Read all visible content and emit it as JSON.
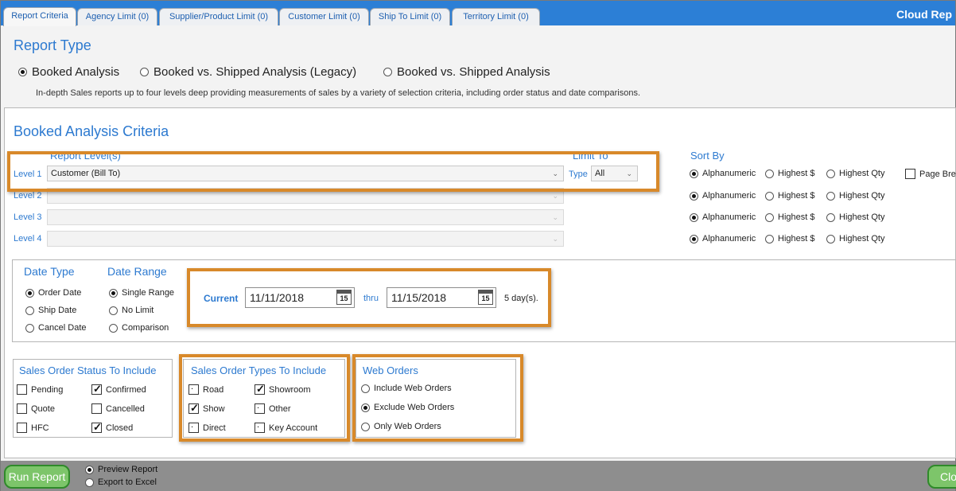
{
  "app": {
    "brand": "Cloud Rep"
  },
  "tabs": [
    {
      "label": "Report Criteria"
    },
    {
      "label": "Agency Limit (0)"
    },
    {
      "label": "Supplier/Product Limit (0)"
    },
    {
      "label": "Customer Limit (0)"
    },
    {
      "label": "Ship To Limit (0)"
    },
    {
      "label": "Territory Limit (0)"
    }
  ],
  "report_type": {
    "title": "Report Type",
    "options": [
      {
        "label": "Booked Analysis",
        "selected": true
      },
      {
        "label": "Booked vs. Shipped Analysis (Legacy)",
        "selected": false
      },
      {
        "label": "Booked vs. Shipped Analysis",
        "selected": false
      }
    ],
    "description": "In-depth Sales reports up to four levels deep providing measurements of sales by a variety of selection criteria, including order status and date comparisons."
  },
  "criteria": {
    "title": "Booked Analysis Criteria",
    "report_levels_header": "Report Level(s)",
    "limit_to_header": "Limit To",
    "sort_by_header": "Sort By",
    "type_label": "Type",
    "type_value": "All",
    "page_break_label": "Page Brea",
    "levels": [
      {
        "label": "Level 1",
        "value": "Customer (Bill To)"
      },
      {
        "label": "Level 2",
        "value": ""
      },
      {
        "label": "Level 3",
        "value": ""
      },
      {
        "label": "Level 4",
        "value": ""
      }
    ],
    "sort_options": [
      "Alphanumeric",
      "Highest $",
      "Highest Qty"
    ]
  },
  "dates": {
    "date_type_title": "Date Type",
    "date_type_options": [
      {
        "label": "Order Date",
        "selected": true
      },
      {
        "label": "Ship Date",
        "selected": false
      },
      {
        "label": "Cancel Date",
        "selected": false
      }
    ],
    "date_range_title": "Date Range",
    "date_range_options": [
      {
        "label": "Single Range",
        "selected": true
      },
      {
        "label": "No Limit",
        "selected": false
      },
      {
        "label": "Comparison",
        "selected": false
      }
    ],
    "current_label": "Current",
    "from": "11/11/2018",
    "thru_label": "thru",
    "to": "11/15/2018",
    "calendar_day": "15",
    "days": "5 day(s)."
  },
  "status": {
    "title": "Sales Order Status To Include",
    "items": [
      {
        "label": "Pending",
        "checked": false
      },
      {
        "label": "Confirmed",
        "checked": true
      },
      {
        "label": "Quote",
        "checked": false
      },
      {
        "label": "Cancelled",
        "checked": false
      },
      {
        "label": "HFC",
        "checked": false
      },
      {
        "label": "Closed",
        "checked": true
      }
    ]
  },
  "types": {
    "title": "Sales Order Types To Include",
    "items": [
      {
        "label": "Road",
        "checked": false
      },
      {
        "label": "Showroom",
        "checked": true
      },
      {
        "label": "Show",
        "checked": true
      },
      {
        "label": "Other",
        "checked": false
      },
      {
        "label": "Direct",
        "checked": false
      },
      {
        "label": "Key Account",
        "checked": false
      }
    ]
  },
  "web_orders": {
    "title": "Web Orders",
    "options": [
      {
        "label": "Include Web Orders",
        "selected": false
      },
      {
        "label": "Exclude Web Orders",
        "selected": true
      },
      {
        "label": "Only Web Orders",
        "selected": false
      }
    ]
  },
  "bottom": {
    "run_label": "Run Report",
    "preview_label": "Preview Report",
    "export_label": "Export to Excel",
    "close_label": "Clo"
  },
  "colors": {
    "accent": "#2c7fd6",
    "highlight": "#d8892a",
    "button_green": "#7dc56a"
  }
}
